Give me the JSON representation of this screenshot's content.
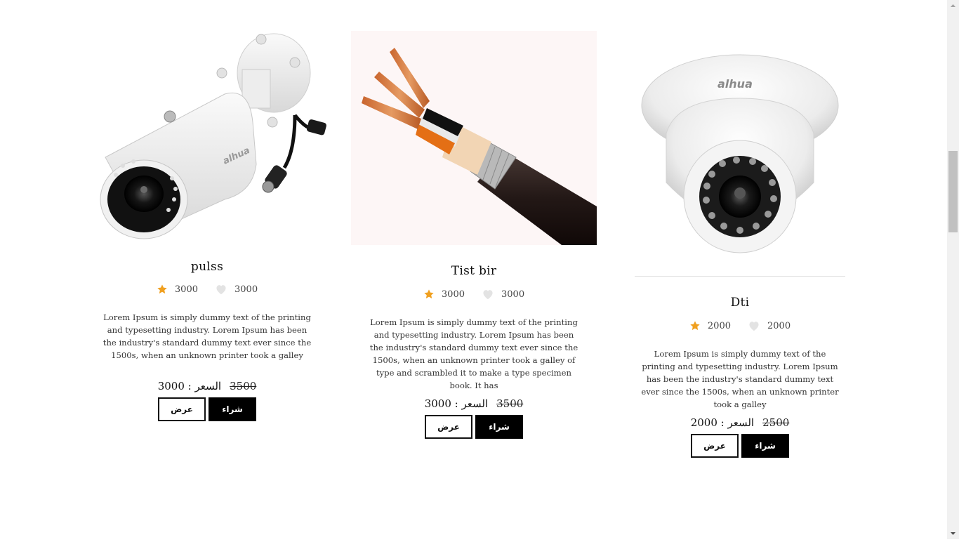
{
  "products": [
    {
      "title": "pulss",
      "rating": "3000",
      "likes": "3000",
      "description": "Lorem Ipsum is simply dummy text of the printing and typesetting industry. Lorem Ipsum has been the industry's standard dummy text ever since the 1500s, when an unknown printer took a galley",
      "price_label": "السعر : 3000",
      "old_price": "3500",
      "buy_label": "شراء",
      "view_label": "عرض",
      "image": "bullet-camera"
    },
    {
      "title": "Tist bir",
      "rating": "3000",
      "likes": "3000",
      "description": "Lorem Ipsum is simply dummy text of the printing and typesetting industry. Lorem Ipsum has been the industry's standard dummy text ever since the 1500s, when an unknown printer took a galley of type and scrambled it to make a type specimen book. It has",
      "price_label": "السعر : 3000",
      "old_price": "3500",
      "buy_label": "شراء",
      "view_label": "عرض",
      "image": "copper-cable"
    },
    {
      "title": "Dti",
      "rating": "2000",
      "likes": "2000",
      "description": "Lorem Ipsum is simply dummy text of the printing and typesetting industry. Lorem Ipsum has been the industry's standard dummy text ever since the 1500s, when an unknown printer took a galley",
      "price_label": "السعر : 2000",
      "old_price": "2500",
      "buy_label": "شراء",
      "view_label": "عرض",
      "image": "dome-camera"
    }
  ],
  "icons": {
    "rating": "star-icon",
    "likes": "heart-icon"
  },
  "colors": {
    "star": "#f0a020",
    "heart": "#e3e3e3",
    "button_dark": "#000000",
    "text": "#222222"
  }
}
